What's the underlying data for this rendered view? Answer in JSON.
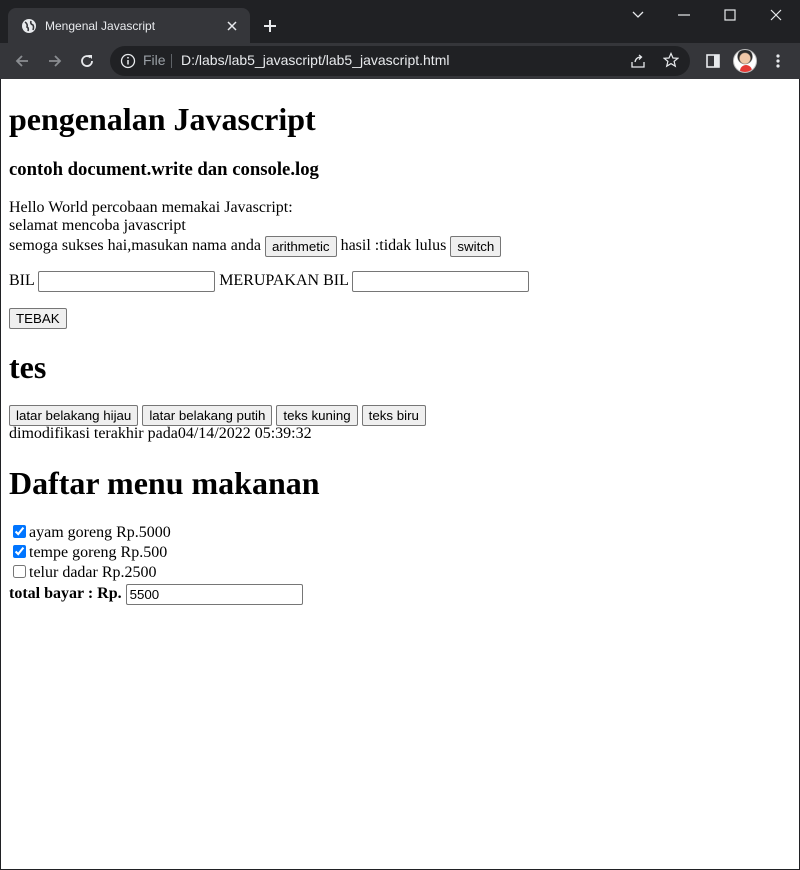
{
  "browser": {
    "tab_title": "Mengenal Javascript",
    "file_label": "File",
    "url": "D:/labs/lab5_javascript/lab5_javascript.html"
  },
  "page": {
    "heading_main": "pengenalan Javascript",
    "subheading": "contoh document.write dan console.log",
    "line1": "Hello World percobaan memakai Javascript:",
    "line2": "selamat mencoba javascript",
    "line3_prefix": "semoga sukses hai,masukan nama anda",
    "arithmetic_label": "arithmetic",
    "hasil_text": "hasil :tidak lulus",
    "switch_label": "switch",
    "bil_label": "BIL",
    "bil_value": "",
    "merupakan_label": "MERUPAKAN BIL",
    "merupakan_value": "",
    "tebak_label": "TEBAK",
    "heading_tes": "tes",
    "btn_hijau": "latar belakang hijau",
    "btn_putih": "latar belakang putih",
    "btn_kuning": "teks kuning",
    "btn_biru": "teks biru",
    "modified_text": "dimodifikasi terakhir pada04/14/2022 05:39:32",
    "heading_menu": "Daftar menu makanan",
    "menu_items": [
      {
        "label": "ayam goreng Rp.5000",
        "checked": true
      },
      {
        "label": "tempe goreng Rp.500",
        "checked": true
      },
      {
        "label": "telur dadar Rp.2500",
        "checked": false
      }
    ],
    "total_label": "total bayar : Rp.",
    "total_value": "5500"
  }
}
